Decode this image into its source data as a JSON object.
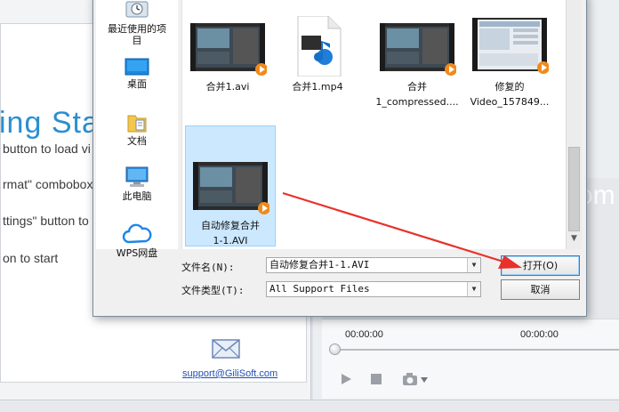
{
  "background": {
    "title_fragment": "ing Sta",
    "steps": [
      "button to load vi",
      "rmat\" combobox",
      "ttings\" button to s",
      "on to start"
    ],
    "support_link": "support@GiliSoft.com",
    "preview_text": "om",
    "time_start": "00:00:00",
    "time_end": "00:00:00",
    "mail_icon": "mail-icon",
    "play_icon": "play-icon",
    "stop_icon": "stop-icon",
    "camera_icon": "camera-icon"
  },
  "dialog": {
    "nav": [
      {
        "label": "最近使用的项目",
        "icon": "recent-icon"
      },
      {
        "label": "桌面",
        "icon": "desktop-icon"
      },
      {
        "label": "文档",
        "icon": "documents-icon"
      },
      {
        "label": "此电脑",
        "icon": "this-pc-icon"
      },
      {
        "label": "WPS网盘",
        "icon": "cloud-icon"
      }
    ],
    "files": [
      {
        "line1": "合并1.avi",
        "line2": "",
        "type": "video"
      },
      {
        "line1": "合并1.mp4",
        "line2": "",
        "type": "mp4"
      },
      {
        "line1": "合并",
        "line2": "1_compressed....",
        "type": "video"
      },
      {
        "line1": "修复的",
        "line2": "Video_157849...",
        "type": "video-screen"
      },
      {
        "line1": "自动修复合并",
        "line2": "1-1.AVI",
        "type": "video",
        "selected": true
      }
    ],
    "filename_label": "文件名(N):",
    "filename_value": "自动修复合并1-1.AVI",
    "filetype_label": "文件类型(T):",
    "filetype_value": "All Support Files",
    "open_button": "打开(O)",
    "cancel_button": "取消"
  },
  "colors": {
    "accent": "#2a8fd0",
    "selection": "#cce8ff",
    "annotation_arrow": "#e8312b"
  }
}
